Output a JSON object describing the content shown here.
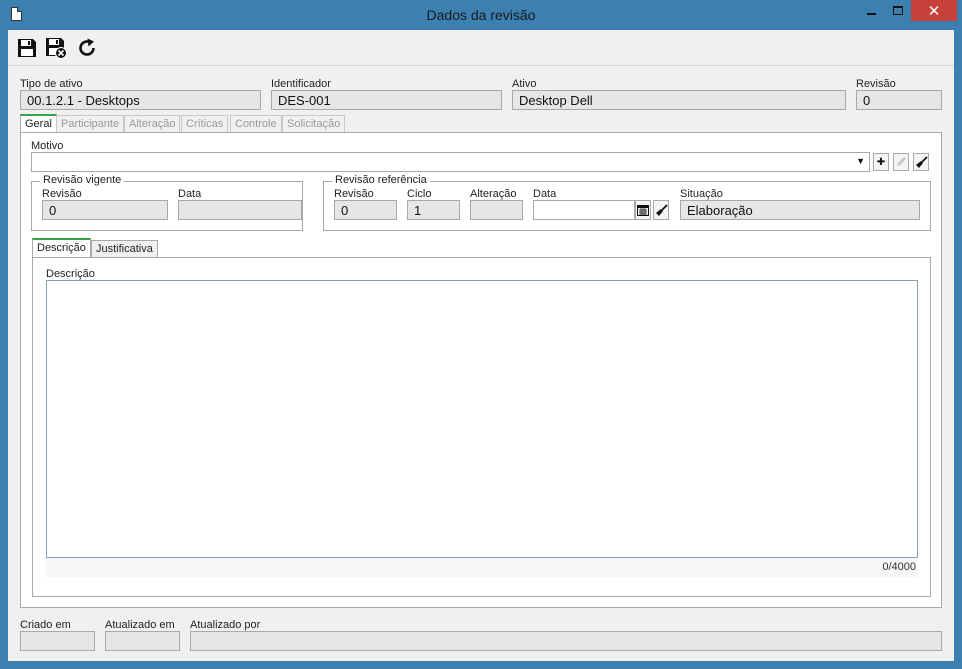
{
  "window": {
    "title": "Dados da revisão",
    "close_glyph": "✕"
  },
  "toolbar": {
    "buttons": [
      "save-icon",
      "save-and-close-icon",
      "refresh-icon"
    ]
  },
  "header": {
    "tipo_label": "Tipo de ativo",
    "tipo_value": "00.1.2.1 - Desktops",
    "identificador_label": "Identificador",
    "identificador_value": "DES-001",
    "ativo_label": "Ativo",
    "ativo_value": "Desktop Dell",
    "revisao_label": "Revisão",
    "revisao_value": "0"
  },
  "tabs": [
    "Geral",
    "Participante",
    "Alteração",
    "Críticas",
    "Controle",
    "Solicitação"
  ],
  "geral": {
    "motivo_label": "Motivo",
    "motivo_value": "",
    "dropdown_glyph": "▼",
    "add_glyph": "✚",
    "revisao_vigente": {
      "title": "Revisão vigente",
      "revisao_label": "Revisão",
      "revisao_value": "0",
      "data_label": "Data",
      "data_value": ""
    },
    "revisao_referencia": {
      "title": "Revisão referência",
      "revisao_label": "Revisão",
      "revisao_value": "0",
      "ciclo_label": "Ciclo",
      "ciclo_value": "1",
      "alteracao_label": "Alteração",
      "alteracao_value": "",
      "data_label": "Data",
      "data_value": "",
      "situacao_label": "Situação",
      "situacao_value": "Elaboração"
    },
    "subtabs": [
      "Descrição",
      "Justificativa"
    ],
    "descricao_label": "Descrição",
    "descricao_value": "",
    "char_counter": "0/4000"
  },
  "footer": {
    "criado_label": "Criado em",
    "criado_value": "",
    "atualizado_label": "Atualizado em",
    "atualizado_value": "",
    "atualizado_por_label": "Atualizado por",
    "atualizado_por_value": ""
  },
  "colors": {
    "title_bar": "#3c7fb1",
    "close_button": "#c7413a",
    "active_tab_accent": "#3aa34a"
  }
}
